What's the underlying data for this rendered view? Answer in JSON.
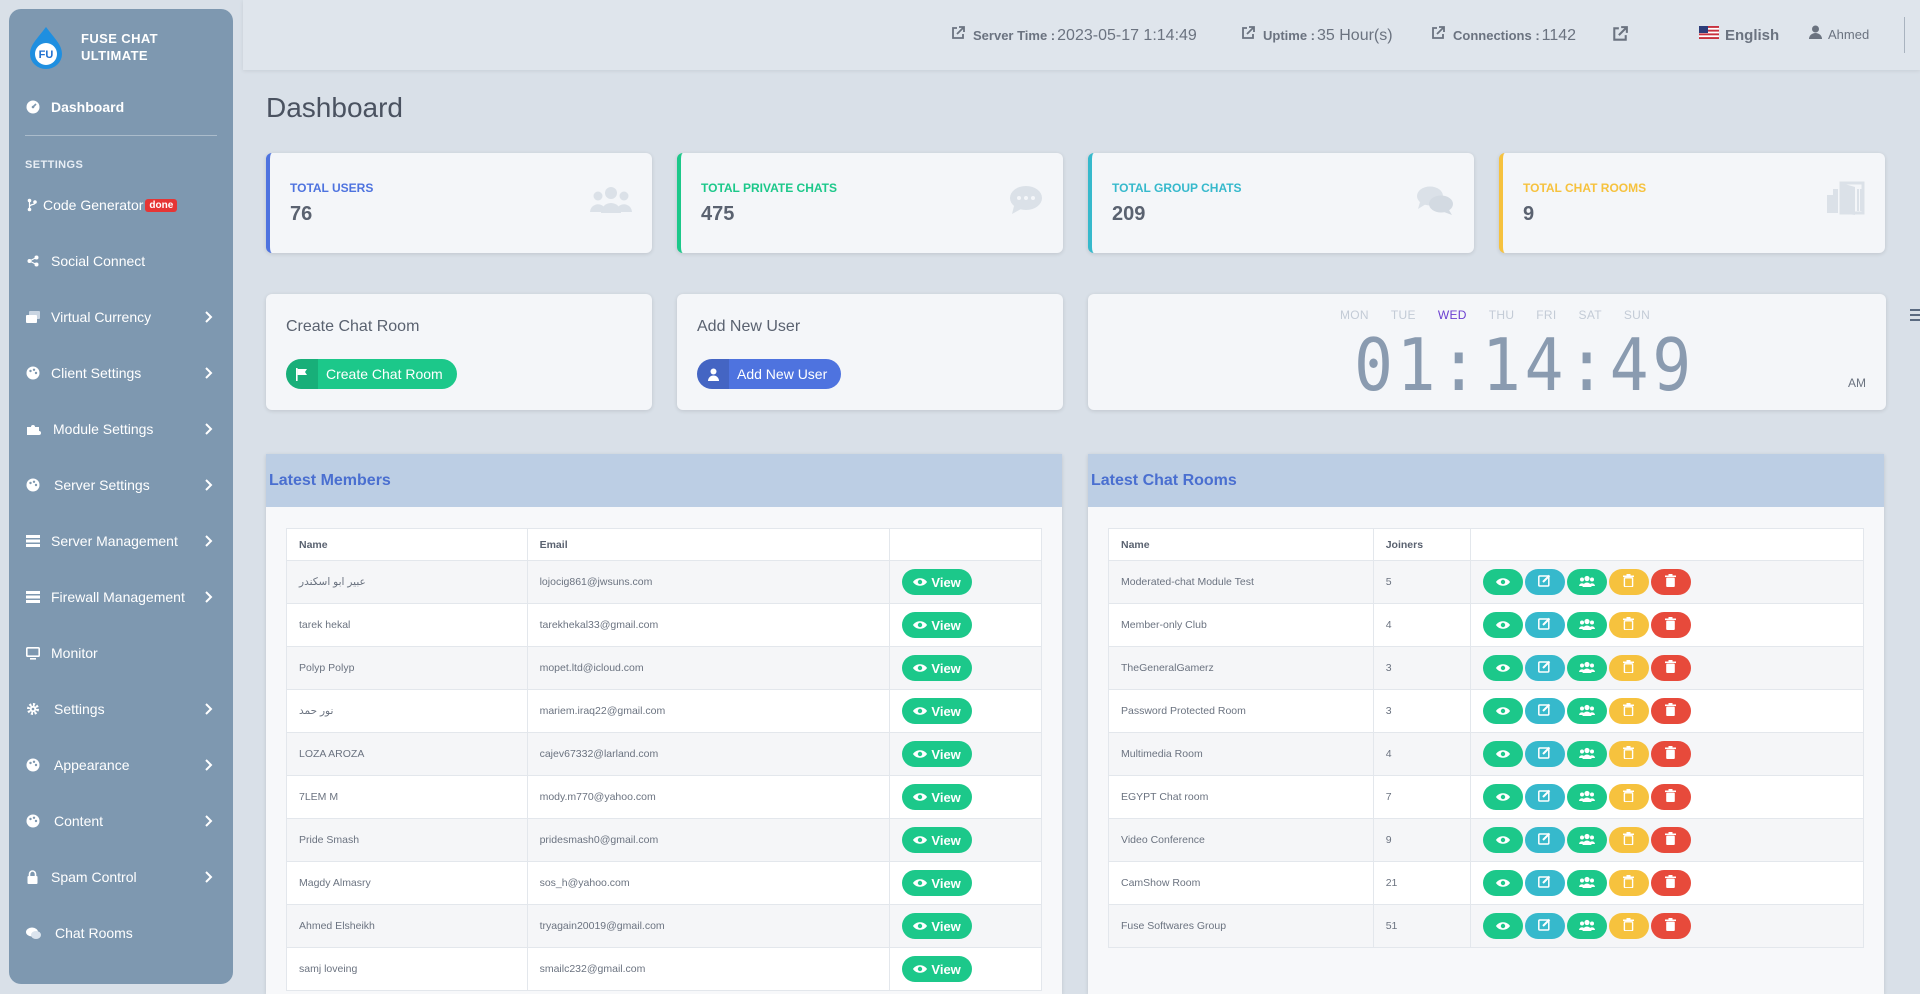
{
  "sidebar": {
    "brand": {
      "logo_text": "FU",
      "line1": "FUSE CHAT",
      "line2": "ULTIMATE"
    },
    "dashboard": "Dashboard",
    "section": "SETTINGS",
    "code_generator": "Code Generator",
    "code_generator_badge": "done",
    "items": [
      {
        "label": "Social Connect"
      },
      {
        "label": "Virtual Currency"
      },
      {
        "label": "Client Settings"
      },
      {
        "label": "Module Settings"
      },
      {
        "label": "Server Settings"
      },
      {
        "label": "Server Management"
      },
      {
        "label": "Firewall Management"
      },
      {
        "label": "Monitor"
      },
      {
        "label": "Settings"
      },
      {
        "label": "Appearance"
      },
      {
        "label": "Content"
      },
      {
        "label": "Spam Control"
      },
      {
        "label": "Chat Rooms"
      }
    ]
  },
  "topbar": {
    "server_time_label": "Server Time :",
    "server_time_value": "2023-05-17 1:14:49",
    "uptime_label": "Uptime :",
    "uptime_value": "35 Hour(s)",
    "connections_label": "Connections :",
    "connections_value": "1142",
    "language": "English",
    "user": "Ahmed"
  },
  "page_title": "Dashboard",
  "stats": [
    {
      "label": "TOTAL USERS",
      "value": "76",
      "color": "#4e73df"
    },
    {
      "label": "TOTAL PRIVATE CHATS",
      "value": "475",
      "color": "#1cc88a"
    },
    {
      "label": "TOTAL GROUP CHATS",
      "value": "209",
      "color": "#36b9cc"
    },
    {
      "label": "TOTAL CHAT ROOMS",
      "value": "9",
      "color": "#f6c23e"
    }
  ],
  "actions": {
    "create_room_title": "Create Chat Room",
    "create_room_button": "Create Chat Room",
    "add_user_title": "Add New User",
    "add_user_button": "Add New User"
  },
  "clock": {
    "days": [
      "MON",
      "TUE",
      "WED",
      "THU",
      "FRI",
      "SAT",
      "SUN"
    ],
    "active_day": "WED",
    "time": "01:14:49",
    "ampm": "AM"
  },
  "members": {
    "title": "Latest Members",
    "headers": [
      "Name",
      "Email",
      ""
    ],
    "view_label": "View",
    "rows": [
      {
        "name": "عبير ابو اسكندر",
        "email": "lojocig861@jwsuns.com"
      },
      {
        "name": "tarek hekal",
        "email": "tarekhekal33@gmail.com"
      },
      {
        "name": "Polyp Polyp",
        "email": "mopet.ltd@icloud.com"
      },
      {
        "name": "نور حمد",
        "email": "mariem.iraq22@gmail.com"
      },
      {
        "name": "LOZA AROZA",
        "email": "cajev67332@larland.com"
      },
      {
        "name": "7LEM M",
        "email": "mody.m770@yahoo.com"
      },
      {
        "name": "Pride Smash",
        "email": "pridesmash0@gmail.com"
      },
      {
        "name": "Magdy Almasry",
        "email": "sos_h@yahoo.com"
      },
      {
        "name": "Ahmed Elsheikh",
        "email": "tryagain20019@gmail.com"
      },
      {
        "name": "samj loveing",
        "email": "smailc232@gmail.com"
      }
    ]
  },
  "rooms": {
    "title": "Latest Chat Rooms",
    "headers": [
      "Name",
      "Joiners",
      ""
    ],
    "rows": [
      {
        "name": "Moderated-chat Module Test",
        "joiners": "5"
      },
      {
        "name": "Member-only Club",
        "joiners": "4"
      },
      {
        "name": "TheGeneralGamerz",
        "joiners": "3"
      },
      {
        "name": "Password Protected Room",
        "joiners": "3"
      },
      {
        "name": "Multimedia Room",
        "joiners": "4"
      },
      {
        "name": "EGYPT Chat room",
        "joiners": "7"
      },
      {
        "name": "Video Conference",
        "joiners": "9"
      },
      {
        "name": "CamShow Room",
        "joiners": "21"
      },
      {
        "name": "Fuse Softwares Group",
        "joiners": "51"
      }
    ],
    "button_colors": [
      "#1cc88a",
      "#36b9cc",
      "#1cc88a",
      "#f6c23e",
      "#e74a3b"
    ]
  }
}
